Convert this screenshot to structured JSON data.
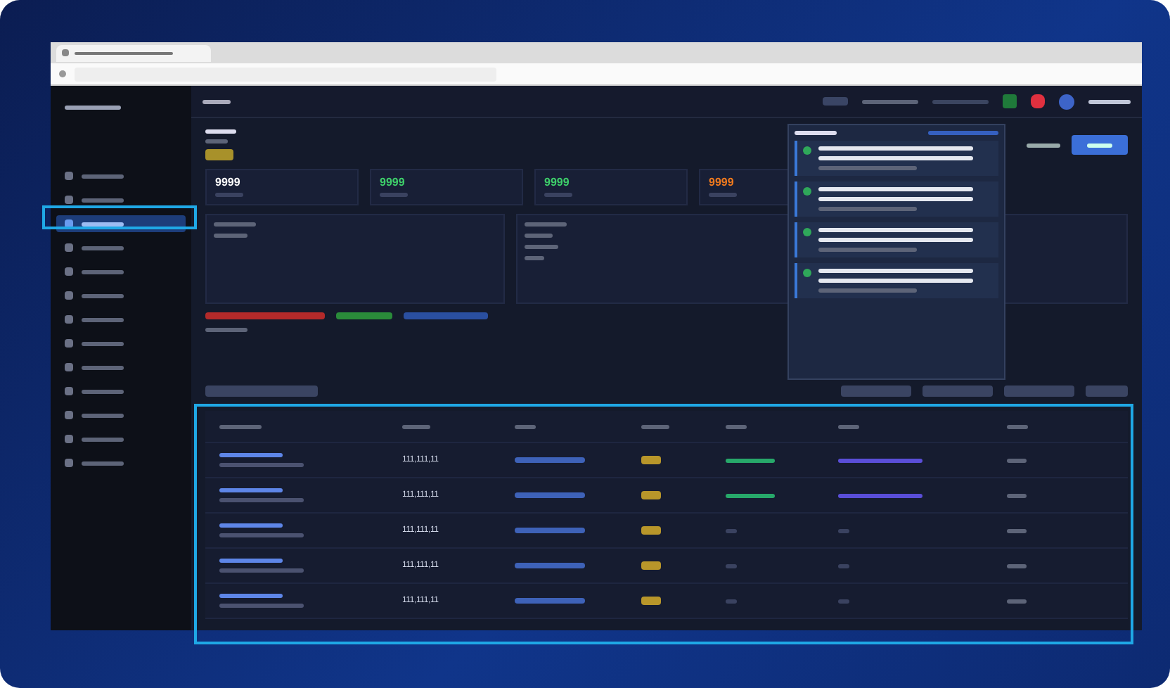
{
  "sidebar": {
    "items": [
      {
        "selected": false
      },
      {
        "selected": false
      },
      {
        "selected": true
      },
      {
        "selected": false
      },
      {
        "selected": false
      },
      {
        "selected": false
      },
      {
        "selected": false
      },
      {
        "selected": false
      },
      {
        "selected": false
      },
      {
        "selected": false
      },
      {
        "selected": false
      },
      {
        "selected": false
      },
      {
        "selected": false
      }
    ]
  },
  "stats": [
    {
      "value": "9999",
      "color": "#ffffff"
    },
    {
      "value": "9999",
      "color": "#3ecf6a"
    },
    {
      "value": "9999",
      "color": "#3ecf6a"
    },
    {
      "value": "9999",
      "color": "#f07a1e"
    }
  ],
  "table": {
    "rows": [
      {
        "amount": "111,111,11"
      },
      {
        "amount": "111,111,11"
      },
      {
        "amount": "111,111,11"
      },
      {
        "amount": "111,111,11"
      },
      {
        "amount": "111,111,11"
      }
    ]
  }
}
